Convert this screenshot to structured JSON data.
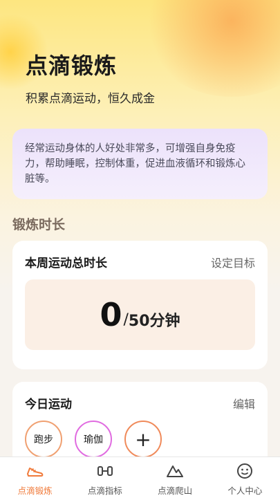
{
  "header": {
    "title": "点滴锻炼",
    "subtitle": "积累点滴运动，恒久成金"
  },
  "info": {
    "text": "经常运动身体的人好处非常多，可增强自身免疫力，帮助睡眠，控制体重，促进血液循环和锻炼心脏等。"
  },
  "section": {
    "title": "锻炼时长"
  },
  "weekly": {
    "title": "本周运动总时长",
    "action": "设定目标",
    "current": "0",
    "separator": "/",
    "target": "50分钟"
  },
  "today": {
    "title": "今日运动",
    "action": "编辑",
    "activities": [
      {
        "label": "跑步"
      },
      {
        "label": "瑜伽"
      }
    ],
    "add_label": "+"
  },
  "tabbar": {
    "tabs": [
      {
        "label": "点滴锻炼",
        "icon": "shoe-icon",
        "active": true
      },
      {
        "label": "点滴指标",
        "icon": "dumbbell-icon",
        "active": false
      },
      {
        "label": "点滴爬山",
        "icon": "mountain-icon",
        "active": false
      },
      {
        "label": "个人中心",
        "icon": "smiley-icon",
        "active": false
      }
    ]
  },
  "colors": {
    "accent": "#f07a3a",
    "run_border": "#f0a071",
    "yoga_border": "#e06be0",
    "info_bg": "#ece2fb"
  }
}
